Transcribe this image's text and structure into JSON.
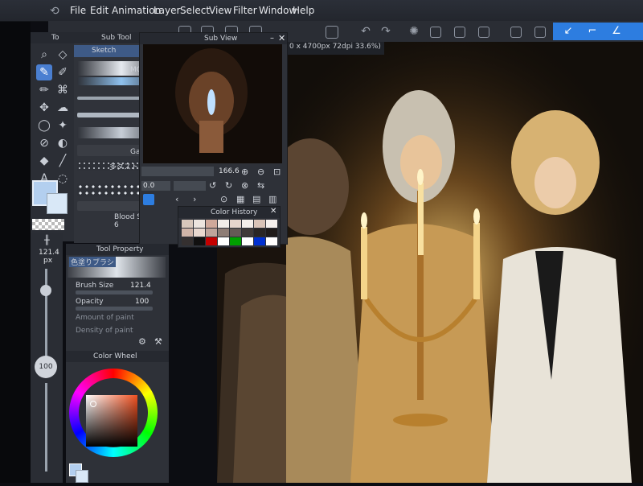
{
  "menu": [
    "File",
    "Edit",
    "Animation",
    "Layer",
    "Select",
    "View",
    "Filter",
    "Window",
    "Help"
  ],
  "doc_info": "0 x 4700px 72dpi 33.6%)",
  "subtool": {
    "tab_label": "Sub Tool",
    "selected_brush": "Sketch",
    "brush_labels": [
      "MO",
      "Ga",
      "多ダスト",
      "Blood Splatter 6"
    ]
  },
  "tool_tab": "To",
  "subview": {
    "title": "Sub View",
    "zoom_value": "166.6",
    "rotate_value": "0.0"
  },
  "color_history": {
    "title": "Color History",
    "swatches": [
      "#d8c7bb",
      "#ece4de",
      "#cfa89a",
      "#f2ede9",
      "#e6d5cc",
      "#f4eeea",
      "#d9c3b7",
      "#f6f1ee",
      "#d1b5a8",
      "#e9d8cf",
      "#bfa49b",
      "#8e7d76",
      "#655a56",
      "#403a38",
      "#2a2624",
      "#1f1b1a",
      "#353030",
      "#111010",
      "#c40000",
      "#ffffff",
      "#00a000",
      "#ffffff",
      "#0030d0",
      "#ffffff"
    ]
  },
  "tool_property": {
    "title": "Tool Property",
    "brush_name": "色塗りブラシ",
    "brush_size_label": "Brush Size",
    "brush_size_value": "121.4",
    "opacity_label": "Opacity",
    "opacity_value": "100",
    "amount_label": "Amount of paint",
    "density_label": "Density of paint"
  },
  "brush_size_col": {
    "value": "121.4",
    "unit": "px",
    "opacity": "100"
  },
  "color_wheel": {
    "title": "Color Wheel",
    "main_color": "#b3cfef",
    "sub_color": "#d9e8f7"
  },
  "colors": {
    "accent": "#2d7de0",
    "panel_bg": "#2e3138"
  }
}
